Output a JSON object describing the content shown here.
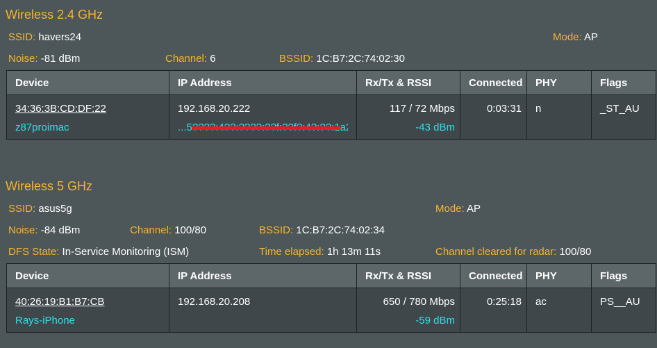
{
  "wireless24": {
    "title": "Wireless 2.4 GHz",
    "ssid_label": "SSID:",
    "ssid": "havers24",
    "mode_label": "Mode:",
    "mode": "AP",
    "noise_label": "Noise:",
    "noise": "-81 dBm",
    "channel_label": "Channel:",
    "channel": "6",
    "bssid_label": "BSSID:",
    "bssid": "1C:B7:2C:74:02:30",
    "headers": [
      "Device",
      "IP Address",
      "Rx/Tx & RSSI",
      "Connected",
      "PHY",
      "Flags"
    ],
    "rows": [
      {
        "mac": "34:36:3B:CD:DF:22",
        "name": "z87proimac",
        "ip": "192.168.20.222",
        "ipv6": "...5????:4??:????:??f:??f?:4?:??:1a2",
        "rate": "117 / 72 Mbps",
        "rssi": "-43 dBm",
        "connected": "0:03:31",
        "phy": "n",
        "flags": "_ST_AU"
      }
    ]
  },
  "wireless5": {
    "title": "Wireless 5 GHz",
    "ssid_label": "SSID:",
    "ssid": "asus5g",
    "mode_label": "Mode:",
    "mode": "AP",
    "noise_label": "Noise:",
    "noise": "-84 dBm",
    "channel_label": "Channel:",
    "channel": "100/80",
    "bssid_label": "BSSID:",
    "bssid": "1C:B7:2C:74:02:34",
    "dfs_label": "DFS State:",
    "dfs": "In-Service Monitoring (ISM)",
    "elapsed_label": "Time elapsed:",
    "elapsed": "1h 13m 11s",
    "cleared_label": "Channel cleared for radar:",
    "cleared": "100/80",
    "headers": [
      "Device",
      "IP Address",
      "Rx/Tx & RSSI",
      "Connected",
      "PHY",
      "Flags"
    ],
    "rows": [
      {
        "mac": "40:26:19:B1:B7:CB",
        "name": "Rays-iPhone",
        "ip": "192.168.20.208",
        "rate": "650 / 780 Mbps",
        "rssi": "-59 dBm",
        "connected": "0:25:18",
        "phy": "ac",
        "flags": "PS__AU"
      }
    ]
  },
  "colors": {
    "accent": "#f5b62d",
    "cyan": "#2ee0e8",
    "background": "#4d5659",
    "redaction": "#e81d1d"
  }
}
